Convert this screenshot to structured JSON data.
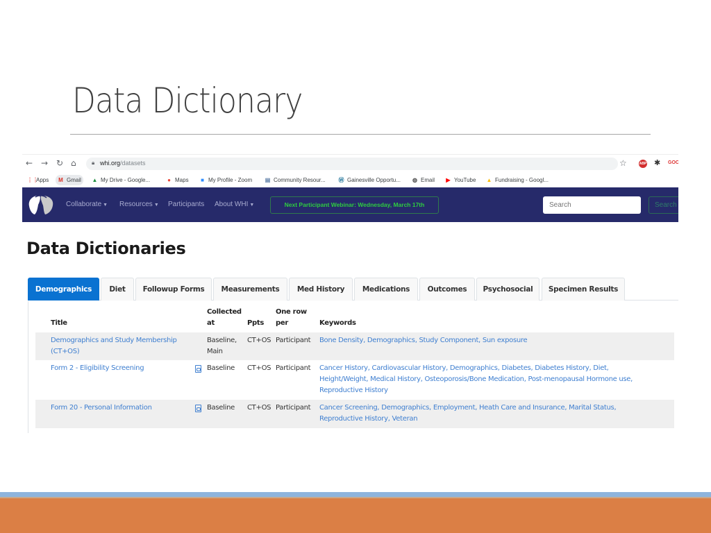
{
  "slide": {
    "title": "Data Dictionary",
    "colors": {
      "footer_orange": "#db7f45",
      "footer_blue": "#8eb4dc"
    }
  },
  "browser": {
    "url_host": "whi.org",
    "url_path": "/datasets",
    "bookmarks": [
      {
        "icon": "apps-grid-icon",
        "label": "Apps"
      },
      {
        "icon": "gmail-icon",
        "label": "Gmail"
      },
      {
        "icon": "google-drive-icon",
        "label": "My Drive - Google..."
      },
      {
        "icon": "maps-pin-icon",
        "label": "Maps"
      },
      {
        "icon": "zoom-icon",
        "label": "My Profile - Zoom"
      },
      {
        "icon": "document-icon",
        "label": "Community Resour..."
      },
      {
        "icon": "wordpress-icon",
        "label": "Gainesville Opportu..."
      },
      {
        "icon": "globe-icon",
        "label": "Email"
      },
      {
        "icon": "youtube-icon",
        "label": "YouTube"
      },
      {
        "icon": "google-drive-icon",
        "label": "Fundraising - Googl..."
      }
    ],
    "extensions": {
      "adblock": "ABP",
      "goc": "GOC"
    }
  },
  "site_nav": {
    "links": [
      {
        "label": "Collaborate",
        "dropdown": true
      },
      {
        "label": "Resources",
        "dropdown": true
      },
      {
        "label": "Participants",
        "dropdown": false
      },
      {
        "label": "About WHI",
        "dropdown": true
      }
    ],
    "announcement": "Next Participant Webinar: Wednesday, March 17th",
    "search_placeholder": "Search",
    "search_button": "Search",
    "colors": {
      "navbar": "#262a6a",
      "announcement": "#2ecc40"
    }
  },
  "page": {
    "heading": "Data Dictionaries",
    "tabs": [
      {
        "label": "Demographics",
        "active": true
      },
      {
        "label": "Diet",
        "active": false
      },
      {
        "label": "Followup Forms",
        "active": false
      },
      {
        "label": "Measurements",
        "active": false
      },
      {
        "label": "Med History",
        "active": false
      },
      {
        "label": "Medications",
        "active": false
      },
      {
        "label": "Outcomes",
        "active": false
      },
      {
        "label": "Psychosocial",
        "active": false
      },
      {
        "label": "Specimen Results",
        "active": false
      }
    ],
    "table": {
      "headers": {
        "title": "Title",
        "collected_at_1": "Collected",
        "collected_at_2": "at",
        "ppts": "Ppts",
        "one_row_per_1": "One row",
        "one_row_per_2": "per",
        "keywords": "Keywords"
      },
      "rows": [
        {
          "title_1": "Demographics and Study Membership",
          "title_2": "(CT+OS)",
          "has_pdf": false,
          "collected_1": "Baseline,",
          "collected_2": "Main",
          "ppts": "CT+OS",
          "per": "Participant",
          "keywords_1": "Bone Density, Demographics, Study Component, Sun exposure",
          "keywords_2": "",
          "keywords_3": ""
        },
        {
          "title_1": "Form 2 - Eligibility Screening",
          "title_2": "",
          "has_pdf": true,
          "collected_1": "Baseline",
          "collected_2": "",
          "ppts": "CT+OS",
          "per": "Participant",
          "keywords_1": "Cancer History, Cardiovascular History, Demographics, Diabetes, Diabetes History, Diet,",
          "keywords_2": "Height/Weight, Medical History, Osteoporosis/Bone Medication, Post-menopausal Hormone use,",
          "keywords_3": "Reproductive History"
        },
        {
          "title_1": "Form 20 - Personal Information",
          "title_2": "",
          "has_pdf": true,
          "collected_1": "Baseline",
          "collected_2": "",
          "ppts": "CT+OS",
          "per": "Participant",
          "keywords_1": "Cancer Screening, Demographics, Employment, Heath Care and Insurance, Marital Status,",
          "keywords_2": "Reproductive History, Veteran",
          "keywords_3": ""
        }
      ]
    }
  }
}
